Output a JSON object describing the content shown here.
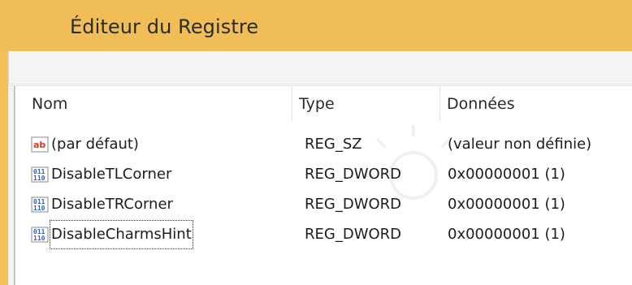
{
  "window": {
    "title": "Éditeur du Registre"
  },
  "list": {
    "columns": [
      {
        "label": "Nom"
      },
      {
        "label": "Type"
      },
      {
        "label": "Données"
      }
    ],
    "rows": [
      {
        "name": "(par défaut)",
        "type": "REG_SZ",
        "data": "(valeur non définie)",
        "icon": "string-value-icon"
      },
      {
        "name": "DisableTLCorner",
        "type": "REG_DWORD",
        "data": "0x00000001 (1)",
        "icon": "binary-value-icon"
      },
      {
        "name": "DisableTRCorner",
        "type": "REG_DWORD",
        "data": "0x00000001 (1)",
        "icon": "binary-value-icon"
      },
      {
        "name": "DisableCharmsHint",
        "type": "REG_DWORD",
        "data": "0x00000001 (1)",
        "icon": "binary-value-icon",
        "focused": true
      }
    ]
  },
  "colors": {
    "titlebar": "#f1bd56",
    "menubar": "#f4f4f4",
    "list_bg": "#ffffff",
    "icon_blue": "#2f63b8",
    "icon_red": "#d23a2a"
  }
}
